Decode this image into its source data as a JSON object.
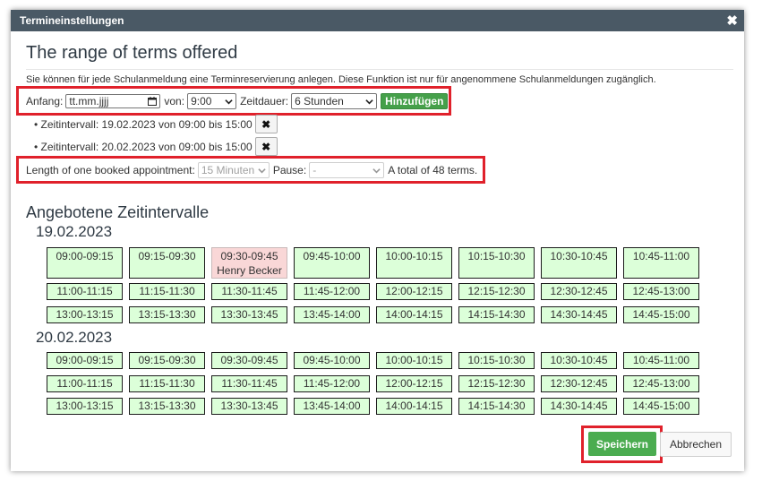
{
  "dialog": {
    "title": "Termineinstellungen",
    "close_glyph": "✖",
    "heading": "The range of terms offered",
    "intro": "Sie können für jede Schulanmeldung eine Terminreservierung anlegen. Diese Funktion ist nur für angenommene Schulanmeldungen zugänglich."
  },
  "form": {
    "start_label": "Anfang:",
    "date_placeholder": "tt.mm.jjjj",
    "from_label": "von:",
    "from_value": "9:00",
    "duration_label": "Zeitdauer:",
    "duration_value": "6 Stunden",
    "add_button": "Hinzufügen"
  },
  "intervals": [
    {
      "text": "• Zeitintervall: 19.02.2023 von 09:00 bis 15:00"
    },
    {
      "text": "• Zeitintervall: 20.02.2023 von 09:00 bis 15:00"
    }
  ],
  "settings": {
    "length_label": "Length of one booked appointment:",
    "length_value": "15 Minuten",
    "pause_label": "Pause:",
    "pause_value": "-",
    "total_text": "A total of 48 terms."
  },
  "offered": {
    "title": "Angebotene Zeitintervalle",
    "days": [
      {
        "date": "19.02.2023",
        "slots": [
          "09:00-09:15",
          "09:15-09:30",
          "09:30-09:45",
          "09:45-10:00",
          "10:00-10:15",
          "10:15-10:30",
          "10:30-10:45",
          "10:45-11:00",
          "11:00-11:15",
          "11:15-11:30",
          "11:30-11:45",
          "11:45-12:00",
          "12:00-12:15",
          "12:15-12:30",
          "12:30-12:45",
          "12:45-13:00",
          "13:00-13:15",
          "13:15-13:30",
          "13:30-13:45",
          "13:45-14:00",
          "14:00-14:15",
          "14:15-14:30",
          "14:30-14:45",
          "14:45-15:00"
        ],
        "booked_name": "Henry Becker"
      },
      {
        "date": "20.02.2023",
        "slots": [
          "09:00-09:15",
          "09:15-09:30",
          "09:30-09:45",
          "09:45-10:00",
          "10:00-10:15",
          "10:15-10:30",
          "10:30-10:45",
          "10:45-11:00",
          "11:00-11:15",
          "11:15-11:30",
          "11:30-11:45",
          "11:45-12:00",
          "12:00-12:15",
          "12:15-12:30",
          "12:30-12:45",
          "12:45-13:00",
          "13:00-13:15",
          "13:15-13:30",
          "13:30-13:45",
          "13:45-14:00",
          "14:00-14:15",
          "14:15-14:30",
          "14:30-14:45",
          "14:45-15:00"
        ]
      }
    ]
  },
  "footer": {
    "save": "Speichern",
    "cancel": "Abbrechen"
  },
  "colors": {
    "titlebar": "#4a5965",
    "highlight": "#e0212b",
    "slot_free": "#dcffd9",
    "slot_booked": "#f9d7d7",
    "save_button": "#4bac50"
  }
}
